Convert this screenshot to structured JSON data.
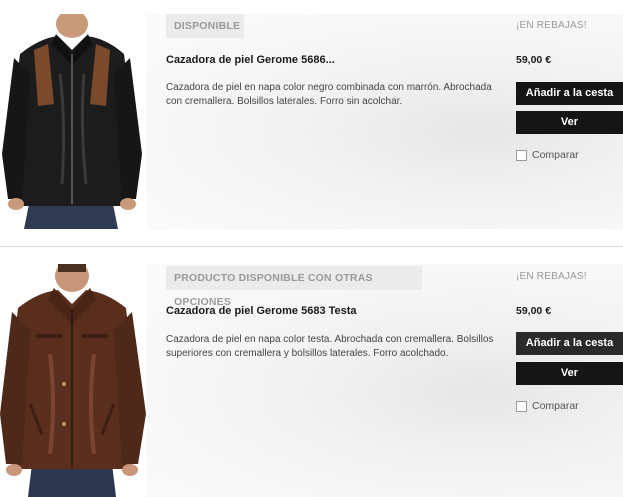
{
  "products": [
    {
      "status": "DISPONIBLE",
      "title": "Cazadora de piel Gerome 5686...",
      "description": "Cazadora de piel en napa color negro combinada con marrón. Abrochada con cremallera. Bolsillos laterales. Forro sin acolchar.",
      "sale_label": "¡EN REBAJAS!",
      "price": "59,00 €",
      "add_to_cart_label": "Añadir a la cesta",
      "view_label": "Ver",
      "compare_label": "Comparar",
      "jacket_color": "#1c1c1c",
      "accent_color": "#7a4a2b"
    },
    {
      "status": "PRODUCTO DISPONIBLE CON OTRAS OPCIONES",
      "title": "Cazadora de piel Gerome 5683 Testa",
      "description": "Cazadora de piel en napa color testa. Abrochada con cremallera. Bolsillos superiores con cremallera y bolsillos laterales. Forro acolchado.",
      "sale_label": "¡EN REBAJAS!",
      "price": "59,00 €",
      "add_to_cart_label": "Añadir a la cesta",
      "view_label": "Ver",
      "compare_label": "Comparar",
      "jacket_color": "#5a2e1c",
      "accent_color": "#7a4530"
    }
  ]
}
